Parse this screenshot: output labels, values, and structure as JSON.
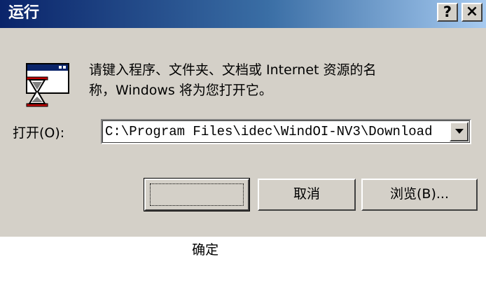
{
  "window": {
    "title": "运行",
    "help_glyph": "?",
    "close_glyph": "×"
  },
  "dialog": {
    "icon": "run-program-icon",
    "description_line1": "请键入程序、文件夹、文档或 Internet 资源的名",
    "description_line2": "称，Windows 将为您打开它。",
    "open_label": "打开(O):",
    "open_value": "C:\\Program Files\\idec\\WindOI-NV3\\Download"
  },
  "buttons": {
    "ok": "确定",
    "cancel": "取消",
    "browse": "浏览(B)..."
  },
  "colors": {
    "titlebar_start": "#0a246a",
    "titlebar_end": "#a6caf0",
    "face": "#d4d0c8"
  }
}
